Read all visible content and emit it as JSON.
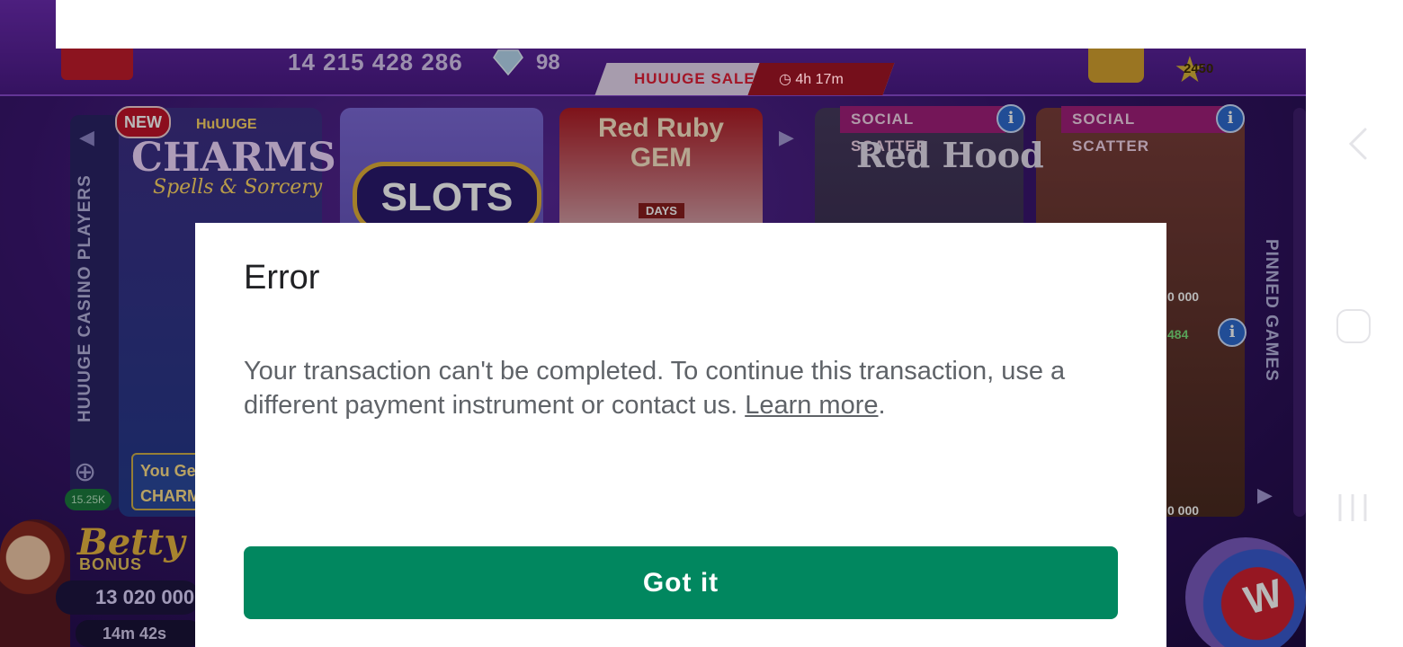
{
  "game": {
    "balance_coins": "14 215 428 286",
    "balance_gems": "98",
    "sale_label": "HUUUGE SALE",
    "sale_timer": "4h 17m",
    "star_level": "2450",
    "left_panel_label": "HUUUGE CASINO PLAYERS",
    "players_count": "15.25K",
    "new_badge": "NEW",
    "tile_charms_top": "HuUUGE",
    "tile_charms": "CHARMS",
    "tile_charms_sub": "Spells & Sorcery",
    "tile_slots": "SLOTS",
    "tile_ruby": "Red Ruby GEM",
    "tile_ruby_days": "DAYS",
    "social_scatter_1": "SOCIAL SCATTER",
    "social_scatter_2": "SOCIAL SCATTER",
    "tile_redhood": "Red Hood",
    "pinned_label": "PINNED GAMES",
    "tile_num_1": "0 000",
    "tile_num_2": "0 000",
    "tile_num_3": "484",
    "you_get": "You Ge\nCHARM",
    "betty": "Betty",
    "bonus": "BONUS",
    "betty_amount": "13 020 000",
    "betty_timer": "14m 42s"
  },
  "dialog": {
    "title": "Error",
    "message": "Your transaction can't be completed. To continue this transaction, use a different payment instrument or contact us.",
    "learn_more": "Learn more",
    "period": ".",
    "button": "Got it",
    "button_color": "#01875f"
  },
  "navbar": {
    "icons": [
      "back-icon",
      "home-icon",
      "recents-icon"
    ]
  }
}
